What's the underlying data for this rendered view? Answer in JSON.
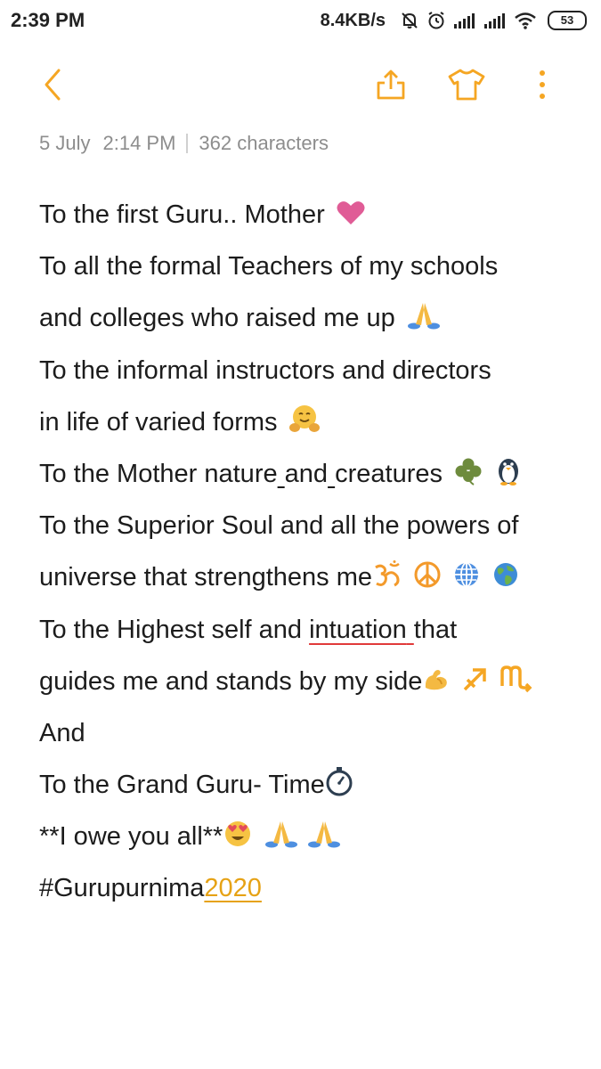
{
  "status_bar": {
    "time": "2:39 PM",
    "net_speed": "8.4KB/s",
    "battery": "53",
    "icons": [
      "mute-bell-icon",
      "alarm-icon",
      "signal-icon",
      "signal-icon",
      "wifi-icon",
      "battery-icon"
    ]
  },
  "toolbar": {
    "icons": [
      "back-arrow-icon",
      "share-icon",
      "theme-shirt-icon",
      "more-vertical-icon"
    ],
    "accent_color": "#F5A623"
  },
  "meta": {
    "date": "5 July",
    "time": "2:14 PM",
    "characters": "362 characters"
  },
  "note": {
    "line1": "To the first Guru.. Mother",
    "line2": "To all the formal Teachers of my schools",
    "line3": "and colleges who raised me up",
    "line4": "To the informal instructors and directors",
    "line5": "in life of varied forms",
    "line6_a": "To the Mother nature",
    "line6_b": "and",
    "line6_c": "creatures",
    "line7": "To the Superior Soul and all the powers of",
    "line8": "universe that strengthens me",
    "line9_a": "To the Highest self  and",
    "line9_misspelled": "intuation",
    "line9_b": "that",
    "line10": "guides me and stands by my side",
    "line11": "And",
    "line12": "To the Grand Guru- Time",
    "line13": "**I owe you all**",
    "line14_text": "#Gurupurnima",
    "line14_link": "2020",
    "emojis": {
      "heart": "heart-icon",
      "pray": "folded-hands-icon",
      "hug": "hugging-face-icon",
      "shamrock": "shamrock-icon",
      "penguin": "penguin-icon",
      "om": "om-icon",
      "peace": "peace-icon",
      "globe_meridians": "globe-meridians-icon",
      "earth": "earth-globe-icon",
      "muscle": "flexed-biceps-icon",
      "sagittarius": "sagittarius-icon",
      "scorpio": "scorpio-icon",
      "stopwatch": "stopwatch-icon",
      "heart_eyes": "heart-eyes-face-icon"
    }
  }
}
